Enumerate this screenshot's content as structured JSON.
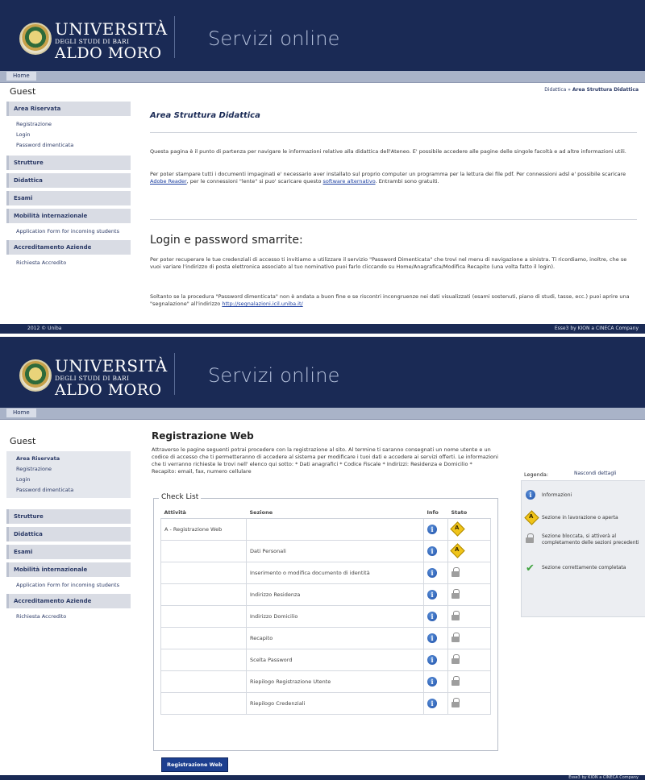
{
  "logo": {
    "line1": "UNIVERSITÀ",
    "line2": "DEGLI STUDI DI BARI",
    "line3": "ALDO MORO"
  },
  "banner_title": "Servizi online",
  "nav_home": "Home",
  "sidebar": {
    "guest": "Guest",
    "area_riservata": "Area Riservata",
    "area_items": [
      "Registrazione",
      "Login",
      "Password dimenticata"
    ],
    "strutture": "Strutture",
    "didattica": "Didattica",
    "esami": "Esami",
    "mobilita": "Mobilità internazionale",
    "application_form": "Application Form for incoming students",
    "accreditamento": "Accreditamento Aziende",
    "richiesta": "Richiesta Accredito"
  },
  "page1": {
    "breadcrumb_link": "Didattica",
    "breadcrumb_sep": "»",
    "breadcrumb_current": "Area Struttura Didattica",
    "heading": "Area Struttura Didattica",
    "intro": "Questa pagina è il punto di partenza per navigare le informazioni relative alla didattica dell'Ateneo. E' possibile accedere alle pagine delle singole facoltà e ad altre informazioni utili.",
    "print_text_1": "Per poter stampare tutti i documenti impaginati e' necessario aver installato sul proprio computer un programma per la lettura dei file pdf. Per connessioni adsl e' possibile scaricare",
    "adobe_link": "Adobe Reader",
    "print_text_2": ", per le connessioni \"lente\" si puo' scaricare questo",
    "alt_link": "software alternativo",
    "print_text_3": ". Entrambi sono gratuiti.",
    "login_heading": "Login e password smarrite:",
    "login_p1": "Per poter recuperare le tue credenziali di accesso ti invitiamo a utilizzare il servizio \"Password Dimenticata\" che trovi nel menu di navigazione a sinistra. Ti ricordiamo, inoltre, che se vuoi variare l'indirizzo di posta elettronica associato al tuo nominativo puoi farlo cliccando su Home/Anagrafica/Modifica Recapito (una volta fatto il login).",
    "login_p2_a": "Soltanto se la procedura \"Password dimenticata\" non è andata a buon fine e se riscontri incongruenze nei dati visualizzati (esami sostenuti, piano di studi, tasse, ecc.) puoi aprire una \"segnalazione\" all'indirizzo",
    "login_p2_link": "http://segnalazioni.icil.uniba.it/"
  },
  "footer": {
    "left": "2012 © Uniba",
    "right": "Esse3 by KION a CINECA Company"
  },
  "page2": {
    "heading": "Registrazione Web",
    "intro": "Attraverso le pagine seguenti potrai procedere con la registrazione al sito. Al termine ti saranno consegnati un nome utente e un codice di accesso che ti permetteranno di accedere al sistema per modificare i tuoi dati e accedere ai servizi offerti. Le informazioni che ti verranno richieste le trovi nell' elenco qui sotto: * Dati anagrafici * Codice Fiscale * Indirizzi: Residenza e Domicilio * Recapito: email, fax, numero cellulare",
    "checklist_title": "Check List",
    "columns": [
      "Attività",
      "Sezione",
      "Info",
      "Stato"
    ],
    "rows": [
      {
        "attivita": "A - Registrazione Web",
        "sezione": "",
        "stato": "open"
      },
      {
        "attivita": "",
        "sezione": "Dati Personali",
        "stato": "open"
      },
      {
        "attivita": "",
        "sezione": "Inserimento o modifica documento di identità",
        "stato": "locked"
      },
      {
        "attivita": "",
        "sezione": "Indirizzo Residenza",
        "stato": "locked"
      },
      {
        "attivita": "",
        "sezione": "Indirizzo Domicilio",
        "stato": "locked"
      },
      {
        "attivita": "",
        "sezione": "Recapito",
        "stato": "locked"
      },
      {
        "attivita": "",
        "sezione": "Scelta Password",
        "stato": "locked"
      },
      {
        "attivita": "",
        "sezione": "Riepilogo Registrazione Utente",
        "stato": "locked"
      },
      {
        "attivita": "",
        "sezione": "Riepilogo Credenziali",
        "stato": "locked"
      }
    ],
    "button": "Registrazione Web",
    "legend_title": "Legenda:",
    "legend_link": "Nascondi dettagli",
    "legend_items": [
      {
        "icon": "info-icon",
        "text": "Informazioni"
      },
      {
        "icon": "open-section-icon",
        "text": "Sezione in lavorazione o aperta"
      },
      {
        "icon": "lock-icon",
        "text": "Sezione bloccata, si attiverà al completamento delle sezioni precedenti"
      },
      {
        "icon": "check-icon",
        "text": "Sezione correttamente completata"
      }
    ],
    "footer_right": "Esse3 by KION a CINECA Company"
  },
  "colors": {
    "banner": "#1a2a55",
    "navbar": "#a9b3c8",
    "accent": "#1d3f8f"
  }
}
